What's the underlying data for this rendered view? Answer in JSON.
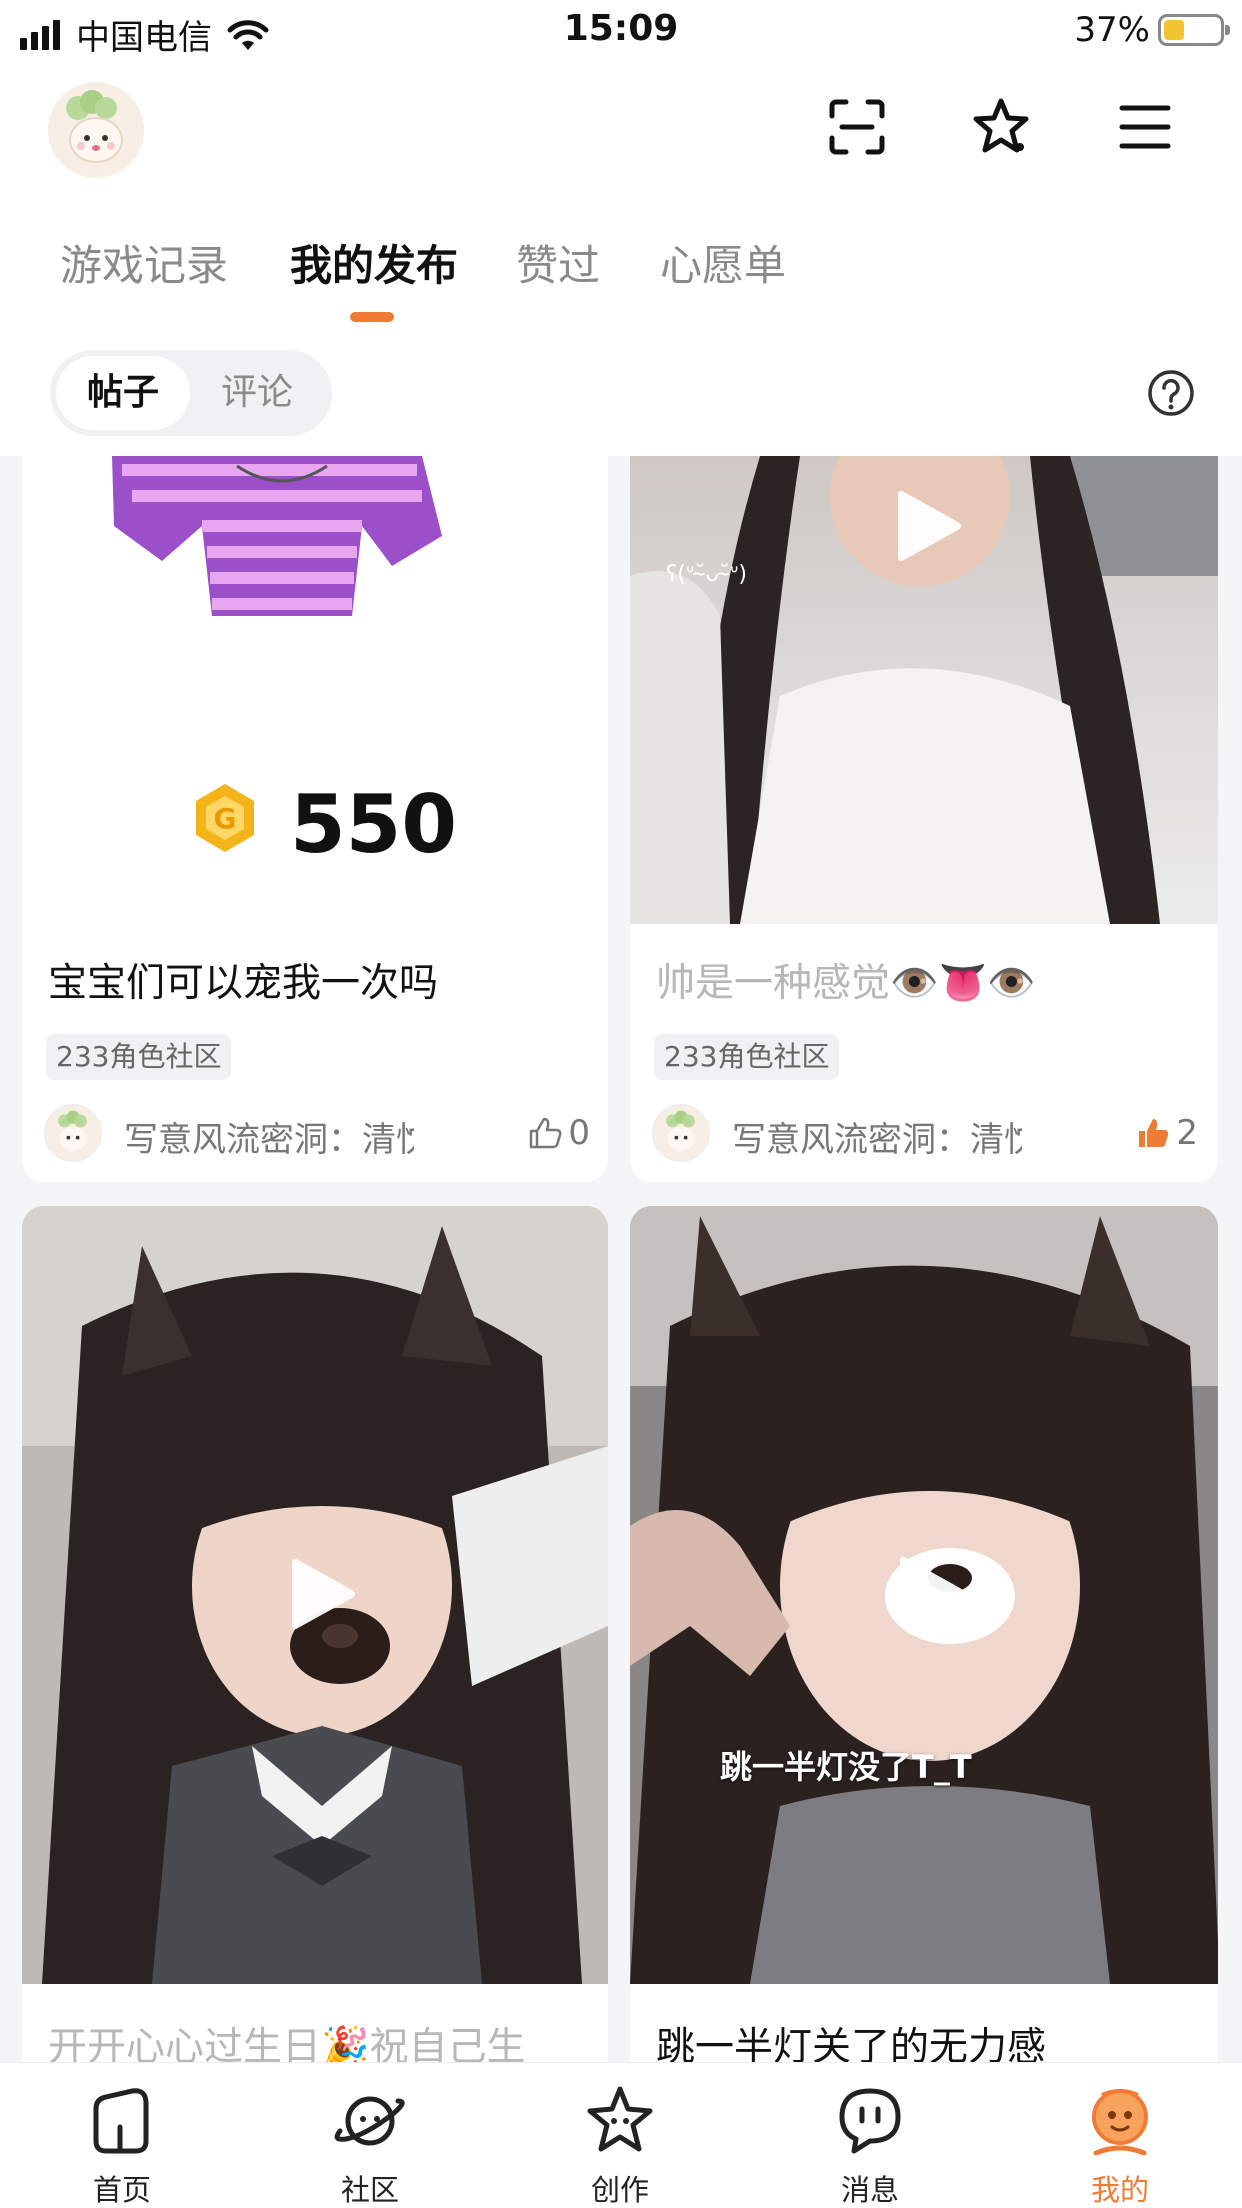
{
  "status_bar": {
    "carrier": "中国电信",
    "time": "15:09",
    "battery": "37%",
    "battery_level": 0.37
  },
  "header": {
    "icons": [
      "scan-icon",
      "star-icon",
      "menu-icon"
    ]
  },
  "tabs": [
    {
      "label": "游戏记录",
      "active": false
    },
    {
      "label": "我的发布",
      "active": true
    },
    {
      "label": "赞过",
      "active": false
    },
    {
      "label": "心愿单",
      "active": false
    }
  ],
  "segment": {
    "options": [
      {
        "label": "帖子",
        "active": true
      },
      {
        "label": "评论",
        "active": false
      }
    ]
  },
  "posts": [
    {
      "title": "宝宝们可以宠我一次吗",
      "price": "550",
      "community": "233角色社区",
      "author": "写意风流密洞：清忱…",
      "likes": "0",
      "liked": false
    },
    {
      "title": "帅是一种感觉👁️👅👁️",
      "community": "233角色社区",
      "author": "写意风流密洞：清忱…",
      "likes": "2",
      "liked": true,
      "overlay_text": "ʕ(ᐡ˘̴ᴗ˘̴ᐡ)"
    },
    {
      "title": "开开心心过生日🎉祝自己生"
    },
    {
      "title": "跳一半灯关了的无力感",
      "caption": "跳一半灯没了T_T"
    }
  ],
  "bottom_nav": [
    {
      "label": "首页",
      "icon": "home-icon",
      "active": false
    },
    {
      "label": "社区",
      "icon": "planet-icon",
      "active": false
    },
    {
      "label": "创作",
      "icon": "create-star-icon",
      "active": false
    },
    {
      "label": "消息",
      "icon": "message-icon",
      "active": false
    },
    {
      "label": "我的",
      "icon": "profile-face-icon",
      "active": true
    }
  ],
  "colors": {
    "accent": "#f07b35",
    "text": "#111111",
    "muted": "#8a8a8a",
    "battery": "#f2c530"
  }
}
